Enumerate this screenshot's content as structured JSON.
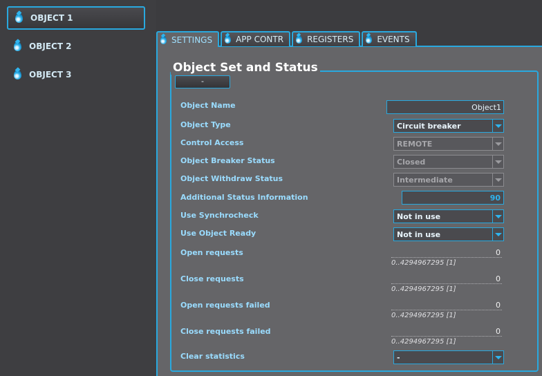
{
  "sidebar": {
    "items": [
      {
        "label": "OBJECT 1",
        "active": true
      },
      {
        "label": "OBJECT 2",
        "active": false
      },
      {
        "label": "OBJECT 3",
        "active": false
      }
    ]
  },
  "tabs": [
    {
      "label": "SETTINGS",
      "active": true
    },
    {
      "label": "APP CONTR",
      "active": false
    },
    {
      "label": "REGISTERS",
      "active": false
    },
    {
      "label": "EVENTS",
      "active": false
    }
  ],
  "group": {
    "title": "Object Set and Status",
    "collapse_label": "-"
  },
  "form": {
    "object_name": {
      "label": "Object Name",
      "value": "Object1"
    },
    "object_type": {
      "label": "Object Type",
      "value": "Circuit breaker"
    },
    "control_access": {
      "label": "Control Access",
      "value": "REMOTE"
    },
    "breaker_status": {
      "label": "Object Breaker Status",
      "value": "Closed"
    },
    "withdraw_status": {
      "label": "Object Withdraw Status",
      "value": "Intermediate"
    },
    "additional_status": {
      "label": "Additional Status Information",
      "value": "90"
    },
    "use_synchrocheck": {
      "label": "Use Synchrocheck",
      "value": "Not in use"
    },
    "use_object_ready": {
      "label": "Use Object Ready",
      "value": "Not in use"
    },
    "open_requests": {
      "label": "Open requests",
      "value": "0",
      "range": "0..4294967295 [1]"
    },
    "close_requests": {
      "label": "Close requests",
      "value": "0",
      "range": "0..4294967295 [1]"
    },
    "open_requests_failed": {
      "label": "Open requests failed",
      "value": "0",
      "range": "0..4294967295 [1]"
    },
    "close_requests_failed": {
      "label": "Close requests failed",
      "value": "0",
      "range": "0..4294967295 [1]"
    },
    "clear_statistics": {
      "label": "Clear statistics",
      "value": "-"
    }
  },
  "icons": {
    "item_icon": "water-drop-icon",
    "dropdown_icon": "chevron-down-icon"
  },
  "colors": {
    "accent": "#29a9df",
    "label": "#9adcff",
    "panel": "#656568",
    "sidebar": "#3e3e41"
  }
}
